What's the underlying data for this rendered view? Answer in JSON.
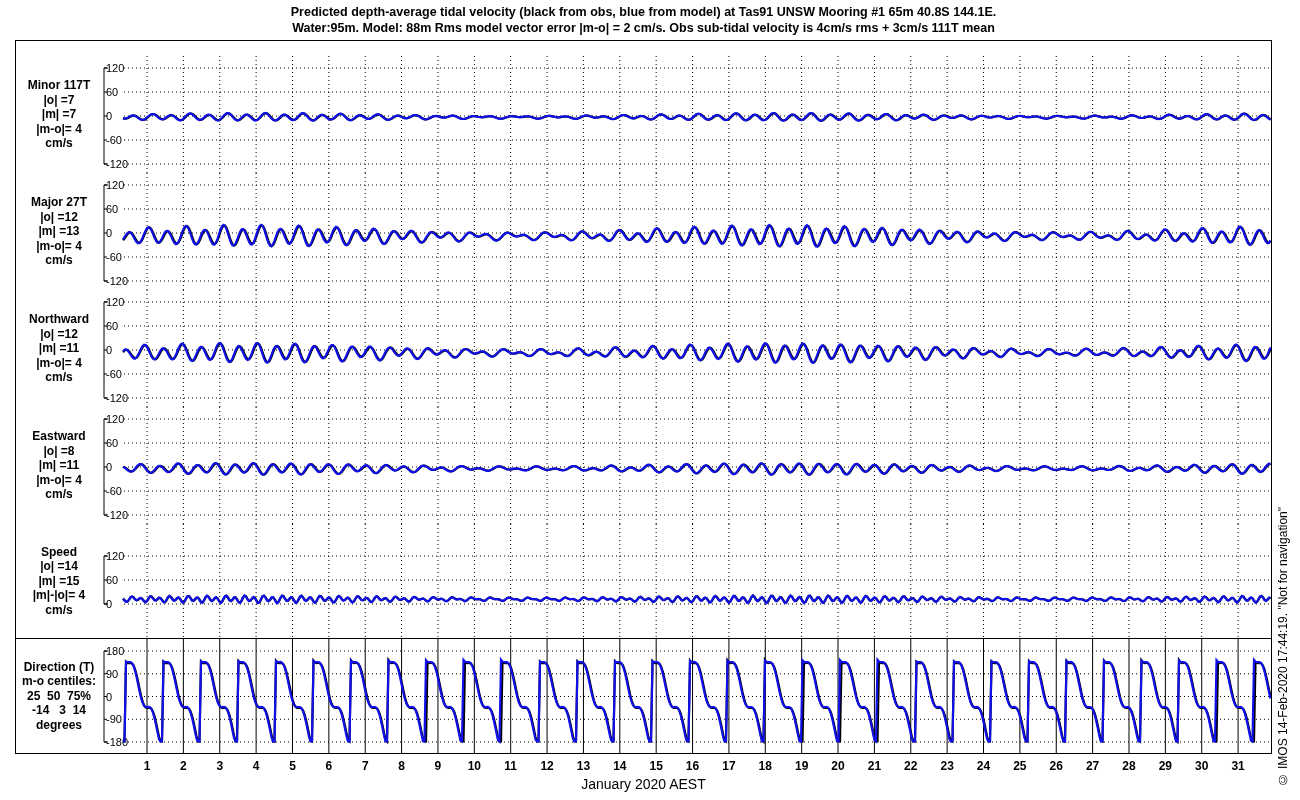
{
  "title": "Predicted depth-average tidal velocity (black from obs, blue from model) at Tas91 UNSW Mooring #1 65m 40.8S 144.1E.",
  "subtitle": "Water:95m. Model: 88m  Rms model vector error |m-o| = 2 cm/s. Obs sub-tidal velocity is 4cm/s rms + 3cm/s 111T mean",
  "panels": [
    {
      "kind": "signed",
      "label_lines": [
        "Minor 117T",
        "|o| =7",
        "|m| =7",
        "|m-o|= 4",
        "cm/s"
      ],
      "y_ticks": [
        "120",
        "60",
        "0",
        "-60",
        "-120"
      ]
    },
    {
      "kind": "signed",
      "label_lines": [
        "Major 27T",
        "|o| =12",
        "|m| =13",
        "|m-o|= 4",
        "cm/s"
      ],
      "y_ticks": [
        "120",
        "60",
        "0",
        "-60",
        "-120"
      ]
    },
    {
      "kind": "signed",
      "label_lines": [
        "Northward",
        "|o| =12",
        "|m| =11",
        "|m-o|= 4",
        "cm/s"
      ],
      "y_ticks": [
        "120",
        "60",
        "0",
        "-60",
        "-120"
      ]
    },
    {
      "kind": "signed",
      "label_lines": [
        "Eastward",
        "|o| =8",
        "|m| =11",
        "|m-o|= 4",
        "cm/s"
      ],
      "y_ticks": [
        "120",
        "60",
        "0",
        "-60",
        "-120"
      ]
    },
    {
      "kind": "magnitude",
      "label_lines": [
        "Speed",
        "|o| =14",
        "|m| =15",
        "|m|-|o|= 4",
        "cm/s"
      ],
      "y_ticks": [
        "120",
        "60",
        "0"
      ]
    },
    {
      "kind": "direction",
      "label_lines": [
        "Direction (T)",
        "m-o centiles:",
        "25  50  75%",
        "-14   3  14",
        "degrees"
      ],
      "y_ticks": [
        "180",
        "90",
        "0",
        "-90",
        "-180"
      ]
    }
  ],
  "x_ticks": [
    "1",
    "2",
    "3",
    "4",
    "5",
    "6",
    "7",
    "8",
    "9",
    "10",
    "11",
    "12",
    "13",
    "14",
    "15",
    "16",
    "17",
    "18",
    "19",
    "20",
    "21",
    "22",
    "23",
    "24",
    "25",
    "26",
    "27",
    "28",
    "29",
    "30",
    "31"
  ],
  "x_label": "January 2020 AEST",
  "footnote": "© IMOS 14-Feb-2020 17:44:19. \"Not for navigation\""
}
